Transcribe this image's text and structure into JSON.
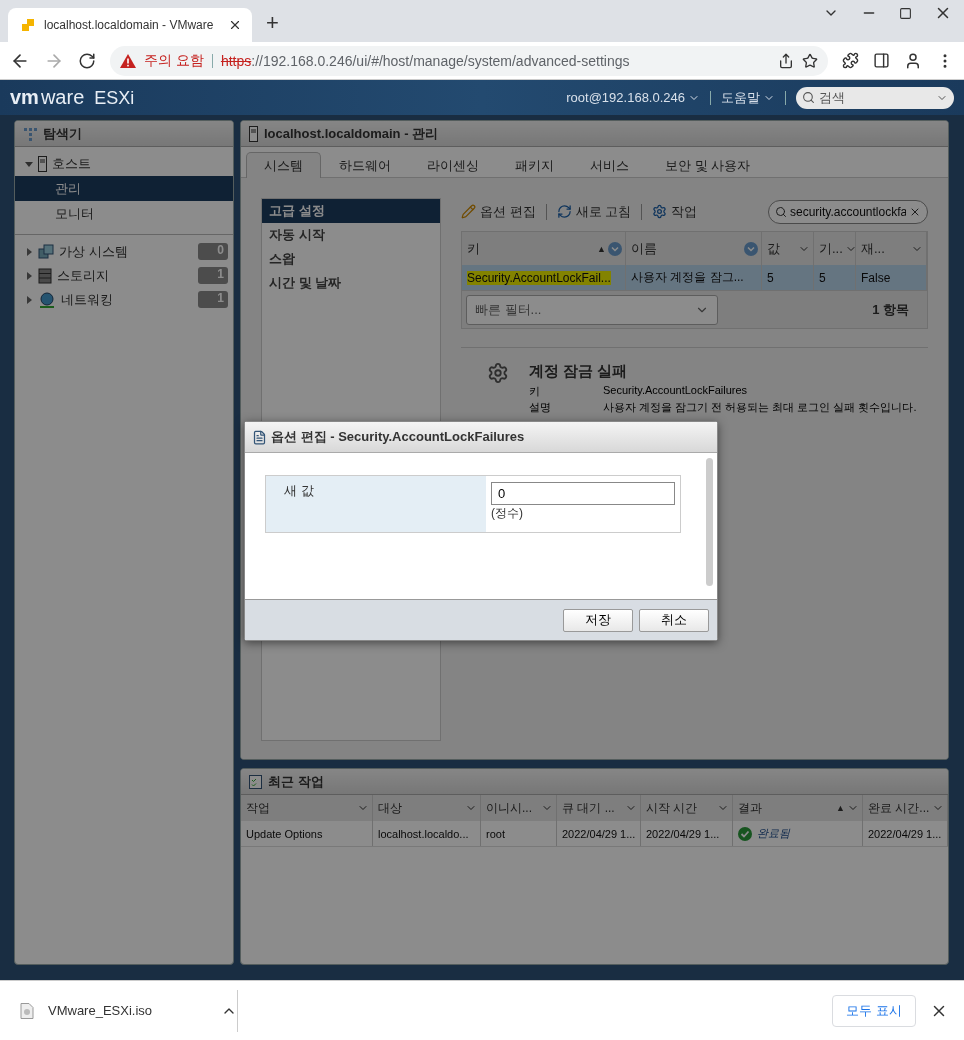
{
  "browser": {
    "tab_title": "localhost.localdomain - VMware",
    "new_tab": "+",
    "warning": "주의 요함",
    "url_scheme": "https",
    "url_rest": "://192.168.0.246/ui/#/host/manage/system/advanced-settings"
  },
  "header": {
    "logo_vm": "vm",
    "logo_ware": "ware",
    "logo_product": "ESXi",
    "user": "root@192.168.0.246",
    "help": "도움말",
    "search_placeholder": "검색"
  },
  "navigator": {
    "title": "탐색기",
    "host": {
      "label": "호스트",
      "expanded": true,
      "children": [
        {
          "label": "관리",
          "selected": true
        },
        {
          "label": "모니터",
          "selected": false
        }
      ]
    },
    "groups": [
      {
        "label": "가상 시스템",
        "count": "0",
        "kind": "vms"
      },
      {
        "label": "스토리지",
        "count": "1",
        "kind": "storage"
      },
      {
        "label": "네트워킹",
        "count": "1",
        "kind": "network"
      }
    ]
  },
  "manage": {
    "title": "localhost.localdomain - 관리",
    "tabs": [
      {
        "label": "시스템",
        "selected": true
      },
      {
        "label": "하드웨어",
        "selected": false
      },
      {
        "label": "라이센싱",
        "selected": false
      },
      {
        "label": "패키지",
        "selected": false
      },
      {
        "label": "서비스",
        "selected": false
      },
      {
        "label": "보안 및 사용자",
        "selected": false
      }
    ],
    "side_menu": [
      {
        "label": "고급 설정",
        "selected": true
      },
      {
        "label": "자동 시작",
        "selected": false
      },
      {
        "label": "스왑",
        "selected": false
      },
      {
        "label": "시간 및 날짜",
        "selected": false
      }
    ],
    "toolbar": [
      {
        "label": "옵션 편집",
        "kind": "edit"
      },
      {
        "label": "새로 고침",
        "kind": "refresh"
      },
      {
        "label": "작업",
        "kind": "actions"
      }
    ],
    "search": {
      "value": "security.accountlockfa"
    },
    "table": {
      "columns": [
        {
          "label": "키",
          "sort_mark": "▲",
          "kind": "filter"
        },
        {
          "label": "이름",
          "kind": "filter"
        },
        {
          "label": "값",
          "kind": "plain"
        },
        {
          "label": "기...",
          "kind": "plain"
        },
        {
          "label": "재...",
          "kind": "plain"
        }
      ],
      "rows": [
        {
          "selected": true,
          "cells": [
            "Security.AccountLockFail...",
            "사용자 계정을 잠그...",
            "5",
            "5",
            "False"
          ]
        }
      ],
      "filter_placeholder": "빠른 필터...",
      "count": "1 항목"
    },
    "detail": {
      "title": "계정 잠금 실패",
      "fields": [
        {
          "label": "키",
          "value": "Security.AccountLockFailures"
        },
        {
          "label": "설명",
          "value": "사용자 계정을 잠그기 전 허용되는 최대 로그인 실패 횟수입니다."
        }
      ]
    }
  },
  "tasks": {
    "title": "최근 작업",
    "columns": [
      {
        "label": "작업"
      },
      {
        "label": "대상"
      },
      {
        "label": "이니시..."
      },
      {
        "label": "큐 대기 ..."
      },
      {
        "label": "시작 시간"
      },
      {
        "label": "결과",
        "sort_mark": "▲"
      },
      {
        "label": "완료 시간..."
      }
    ],
    "rows": [
      {
        "cells": [
          "Update Options",
          "localhost.localdo...",
          "root",
          "2022/04/29 1...",
          "2022/04/29 1...",
          {
            "text": "완료됨",
            "success": true
          },
          "2022/04/29 1..."
        ]
      }
    ]
  },
  "dialog": {
    "title": "옵션 편집 - Security.AccountLockFailures",
    "field_label": "새 값",
    "value": "0",
    "hint": "(정수)",
    "buttons": [
      "저장",
      "취소"
    ]
  },
  "download": {
    "file": "VMware_ESXi.iso",
    "show_all": "모두 표시"
  }
}
